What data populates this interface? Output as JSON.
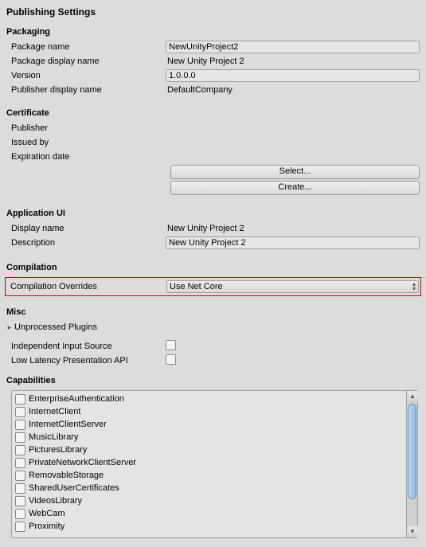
{
  "title": "Publishing Settings",
  "sections": {
    "packaging": {
      "title": "Packaging",
      "package_name_label": "Package name",
      "package_name_value": "NewUnityProject2",
      "package_display_name_label": "Package display name",
      "package_display_name_value": "New Unity Project 2",
      "version_label": "Version",
      "version_value": "1.0.0.0",
      "publisher_display_name_label": "Publisher display name",
      "publisher_display_name_value": "DefaultCompany"
    },
    "certificate": {
      "title": "Certificate",
      "publisher_label": "Publisher",
      "issued_by_label": "Issued by",
      "expiration_label": "Expiration date",
      "select_btn": "Select...",
      "create_btn": "Create..."
    },
    "app_ui": {
      "title": "Application UI",
      "display_name_label": "Display name",
      "display_name_value": "New Unity Project 2",
      "description_label": "Description",
      "description_value": "New Unity Project 2"
    },
    "compilation": {
      "title": "Compilation",
      "overrides_label": "Compilation Overrides",
      "overrides_value": "Use Net Core"
    },
    "misc": {
      "title": "Misc",
      "unprocessed_plugins_label": "Unprocessed Plugins",
      "independent_input_label": "Independent Input Source",
      "low_latency_label": "Low Latency Presentation API"
    },
    "capabilities": {
      "title": "Capabilities",
      "items": [
        "EnterpriseAuthentication",
        "InternetClient",
        "InternetClientServer",
        "MusicLibrary",
        "PicturesLibrary",
        "PrivateNetworkClientServer",
        "RemovableStorage",
        "SharedUserCertificates",
        "VideosLibrary",
        "WebCam",
        "Proximity"
      ]
    }
  }
}
